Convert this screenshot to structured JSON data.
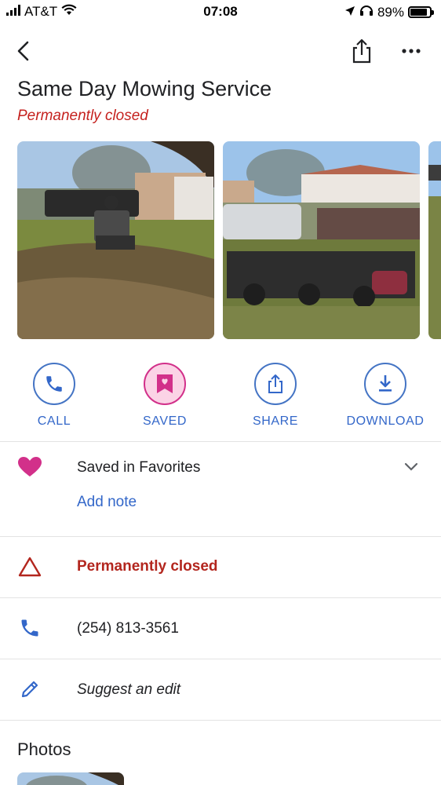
{
  "status_bar": {
    "carrier": "AT&T",
    "time": "07:08",
    "battery_percent": "89%",
    "battery_level": 0.89,
    "icons": [
      "signal-bars-icon",
      "wifi-icon",
      "location-arrow-icon",
      "headphones-icon",
      "battery-icon"
    ]
  },
  "nav": {
    "icons": [
      "back-chevron-icon",
      "share-icon",
      "more-dots-icon"
    ]
  },
  "place": {
    "name": "Same Day Mowing Service",
    "status": "Permanently closed"
  },
  "photos": [
    {
      "description_icon": "photo-mower-on-lawn"
    },
    {
      "description_icon": "photo-mowers-parked"
    },
    {
      "description_icon": "photo-partial"
    }
  ],
  "actions": [
    {
      "label": "CALL",
      "icon": "phone-icon"
    },
    {
      "label": "SAVED",
      "icon": "bookmark-heart-icon"
    },
    {
      "label": "SHARE",
      "icon": "share-icon"
    },
    {
      "label": "DOWNLOAD",
      "icon": "download-icon"
    }
  ],
  "saved": {
    "list_text": "Saved in Favorites",
    "add_note": "Add note",
    "icon": "heart-icon"
  },
  "info": {
    "closed_text": "Permanently closed",
    "phone": "(254) 813-3561",
    "suggest_edit": "Suggest an edit"
  },
  "photos_section": {
    "heading": "Photos"
  },
  "colors": {
    "accent_blue": "#3367c9",
    "closed_red": "#c5221f",
    "saved_pink": "#d2308a"
  }
}
